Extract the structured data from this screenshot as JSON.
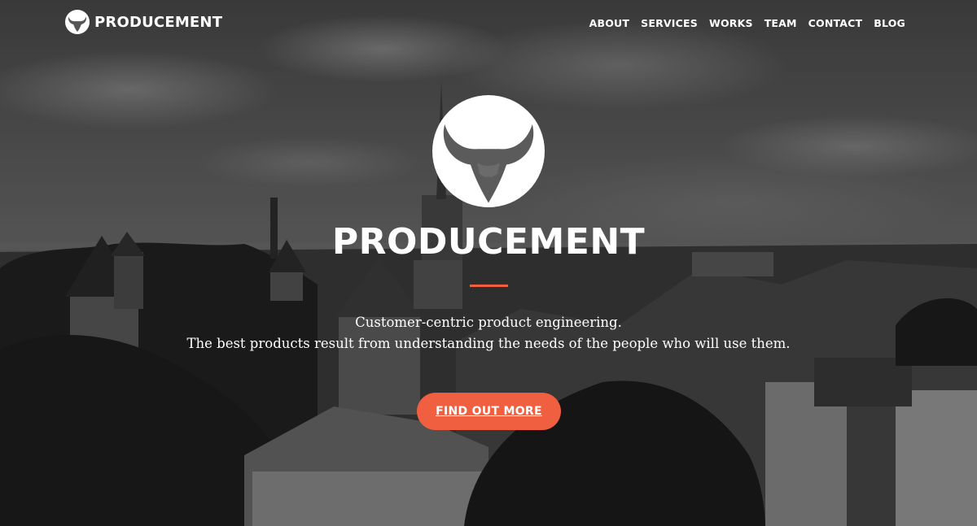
{
  "navbar": {
    "brand": "PRODUCEMENT",
    "brand_icon": "bull-head-icon",
    "links": [
      {
        "label": "ABOUT"
      },
      {
        "label": "SERVICES"
      },
      {
        "label": "WORKS"
      },
      {
        "label": "TEAM"
      },
      {
        "label": "CONTACT"
      },
      {
        "label": "BLOG"
      }
    ]
  },
  "hero": {
    "logo_icon": "bull-head-icon",
    "title": "PRODUCEMENT",
    "lines": [
      "Customer-centric product engineering.",
      "The best products result from understanding the needs of the people who will use them."
    ],
    "cta_label": "FIND OUT MORE"
  },
  "colors": {
    "accent": "#f05f40",
    "text": "#ffffff"
  }
}
